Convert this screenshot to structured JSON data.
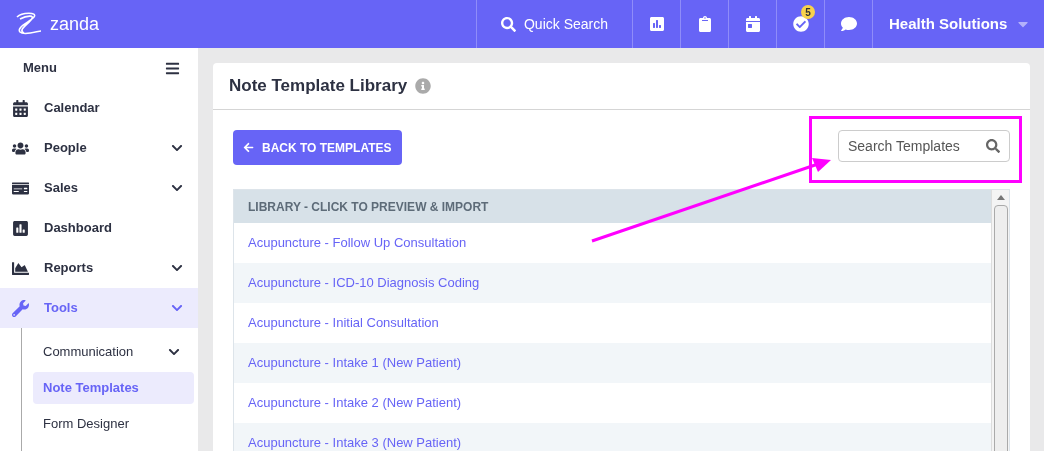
{
  "header": {
    "brand": "zanda",
    "quick_search": "Quick Search",
    "task_badge": "5",
    "account": "Health Solutions"
  },
  "sidebar": {
    "title": "Menu",
    "items": [
      {
        "label": "Calendar",
        "has_submenu": false,
        "selected": false
      },
      {
        "label": "People",
        "has_submenu": true,
        "selected": false
      },
      {
        "label": "Sales",
        "has_submenu": true,
        "selected": false
      },
      {
        "label": "Dashboard",
        "has_submenu": false,
        "selected": false
      },
      {
        "label": "Reports",
        "has_submenu": true,
        "selected": false
      },
      {
        "label": "Tools",
        "has_submenu": true,
        "selected": true,
        "children": [
          {
            "label": "Communication",
            "has_submenu": true,
            "selected": false
          },
          {
            "label": "Note Templates",
            "has_submenu": false,
            "selected": true
          },
          {
            "label": "Form Designer",
            "has_submenu": false,
            "selected": false
          }
        ]
      }
    ]
  },
  "card": {
    "title": "Note Template Library",
    "back_button": "BACK TO TEMPLATES",
    "search": {
      "placeholder": "Search Templates"
    },
    "table": {
      "header": "LIBRARY - CLICK TO PREVIEW & IMPORT",
      "rows": [
        "Acupuncture - Follow Up Consultation",
        "Acupuncture - ICD-10 Diagnosis Coding",
        "Acupuncture - Initial Consultation",
        "Acupuncture - Intake 1 (New Patient)",
        "Acupuncture - Intake 2 (New Patient)",
        "Acupuncture - Intake 3 (New Patient)"
      ]
    }
  }
}
